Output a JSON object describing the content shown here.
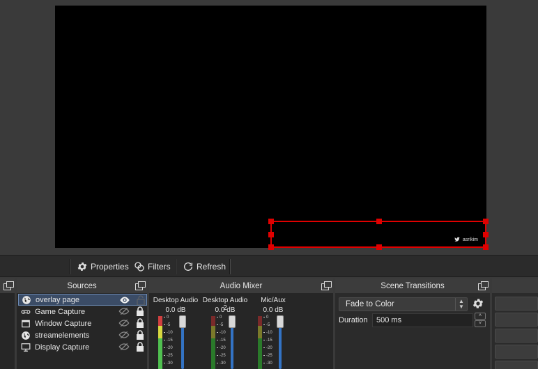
{
  "preview": {
    "overlay_text": "asrikim"
  },
  "context_toolbar": {
    "properties_label": "Properties",
    "filters_label": "Filters",
    "refresh_label": "Refresh"
  },
  "sources": {
    "title": "Sources",
    "items": [
      {
        "label": "overlay page",
        "icon": "browser-globe-icon",
        "visible": true,
        "locked": false,
        "selected": true
      },
      {
        "label": "Game Capture",
        "icon": "gamepad-icon",
        "visible": false,
        "locked": true,
        "selected": false
      },
      {
        "label": "Window Capture",
        "icon": "window-icon",
        "visible": false,
        "locked": true,
        "selected": false
      },
      {
        "label": "streamelements",
        "icon": "browser-globe-icon",
        "visible": false,
        "locked": true,
        "selected": false
      },
      {
        "label": "Display Capture",
        "icon": "monitor-icon",
        "visible": false,
        "locked": true,
        "selected": false
      }
    ]
  },
  "audio_mixer": {
    "title": "Audio Mixer",
    "channels": [
      {
        "name": "Desktop Audio",
        "db": "0.0 dB"
      },
      {
        "name": "Desktop Audio 2",
        "db": "0.0 dB"
      },
      {
        "name": "Mic/Aux",
        "db": "0.0 dB"
      }
    ],
    "ticks": [
      "0",
      "-5",
      "-10",
      "-15",
      "-20",
      "-25",
      "-30"
    ]
  },
  "scene_transitions": {
    "title": "Scene Transitions",
    "transition": "Fade to Color",
    "duration_label": "Duration",
    "duration_value": "500 ms"
  },
  "colors": {
    "selection_handle": "#e00000",
    "fader": "#3373c4",
    "selected_row": "#3b4c66"
  }
}
